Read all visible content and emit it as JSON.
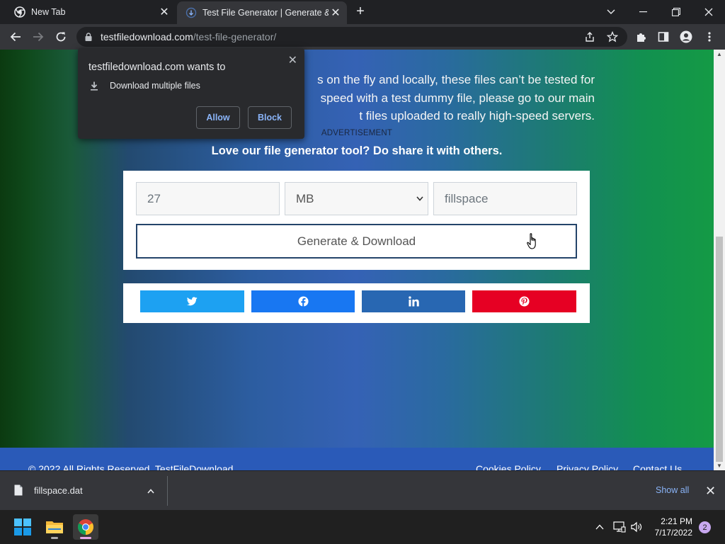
{
  "browser": {
    "tabs": [
      {
        "title": "New Tab",
        "active": false
      },
      {
        "title": "Test File Generator | Generate & D",
        "active": true
      }
    ],
    "address": {
      "host": "testfiledownload.com",
      "path": "/test-file-generator/"
    }
  },
  "popup": {
    "heading": "testfiledownload.com wants to",
    "permission": "Download multiple files",
    "allow_label": "Allow",
    "block_label": "Block"
  },
  "page": {
    "paragraph_lines": [
      "s on the fly and locally, these files can’t be tested for",
      "speed with a test dummy file, please go to our main",
      "t files uploaded to really high-speed servers."
    ],
    "ad_label": "ADVERTISEMENT",
    "share_heading": "Love our file generator tool? Do share it with others.",
    "generator": {
      "size_value": "27",
      "unit_selected": "MB",
      "filename_value": "fillspace",
      "button_label": "Generate & Download"
    },
    "share_buttons": [
      "twitter",
      "facebook",
      "linkedin",
      "pinterest"
    ],
    "footer": {
      "copyright": "© 2022 All Rights Reserved. TestFileDownload",
      "links": [
        "Cookies Policy",
        "Privacy Policy",
        "Contact Us"
      ]
    }
  },
  "downloads": {
    "file_name": "fillspace.dat",
    "show_all_label": "Show all"
  },
  "taskbar": {
    "time": "2:21 PM",
    "date": "7/17/2022",
    "notification_count": "2"
  },
  "colors": {
    "twitter": "#1da1f2",
    "facebook": "#1877f2",
    "linkedin": "#2867b2",
    "pinterest": "#e60023",
    "link_blue": "#8ab4f8"
  }
}
